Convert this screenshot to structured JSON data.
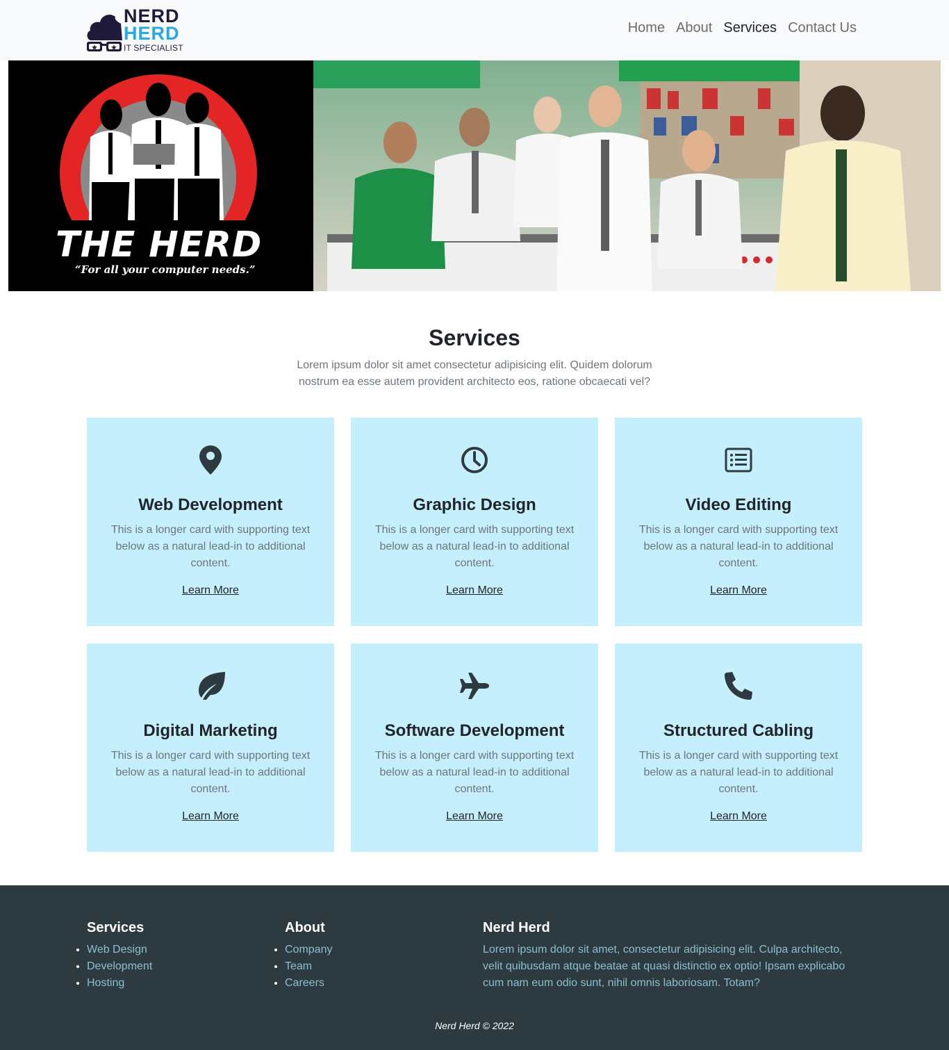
{
  "brand": {
    "line1": "NERD",
    "line2": "HERD",
    "line3": "IT SPECIALIST",
    "colors": {
      "dark": "#1f1a3a",
      "accent": "#29a9e1"
    }
  },
  "nav": {
    "items": [
      {
        "label": "Home"
      },
      {
        "label": "About"
      },
      {
        "label": "Services",
        "active": true
      },
      {
        "label": "Contact Us"
      }
    ]
  },
  "hero": {
    "title": "THE HERD",
    "tagline": "“For all your computer needs.”"
  },
  "services": {
    "title": "Services",
    "subtitle": "Lorem ipsum dolor sit amet consectetur adipisicing elit. Quidem dolorum nostrum ea esse autem provident architecto eos, ratione obcaecati vel?",
    "cards": [
      {
        "icon": "map-pin-icon",
        "title": "Web Development",
        "text": "This is a longer card with supporting text below as a natural lead-in to additional content.",
        "link": "Learn More"
      },
      {
        "icon": "clock-icon",
        "title": "Graphic Design",
        "text": "This is a longer card with supporting text below as a natural lead-in to additional content.",
        "link": "Learn More"
      },
      {
        "icon": "list-icon",
        "title": "Video Editing",
        "text": "This is a longer card with supporting text below as a natural lead-in to additional content.",
        "link": "Learn More"
      },
      {
        "icon": "leaf-icon",
        "title": "Digital Marketing",
        "text": "This is a longer card with supporting text below as a natural lead-in to additional content.",
        "link": "Learn More"
      },
      {
        "icon": "airplane-icon",
        "title": "Software Development",
        "text": "This is a longer card with supporting text below as a natural lead-in to additional content.",
        "link": "Learn More"
      },
      {
        "icon": "phone-icon",
        "title": "Structured Cabling",
        "text": "This is a longer card with supporting text below as a natural lead-in to additional content.",
        "link": "Learn More"
      }
    ],
    "card_color": "#c5effd"
  },
  "footer": {
    "col1": {
      "title": "Services",
      "items": [
        "Web Design",
        "Development",
        "Hosting"
      ]
    },
    "col2": {
      "title": "About",
      "items": [
        "Company",
        "Team",
        "Careers"
      ]
    },
    "col3": {
      "title": "Nerd Herd",
      "text": "Lorem ipsum dolor sit amet, consectetur adipisicing elit. Culpa architecto, velit quibusdam atque beatae at quasi distinctio ex optio! Ipsam explicabo cum nam eum odio sunt, nihil omnis laboriosam. Totam?"
    },
    "copyright": "Nerd Herd © 2022",
    "background": "#2d3a3f"
  }
}
